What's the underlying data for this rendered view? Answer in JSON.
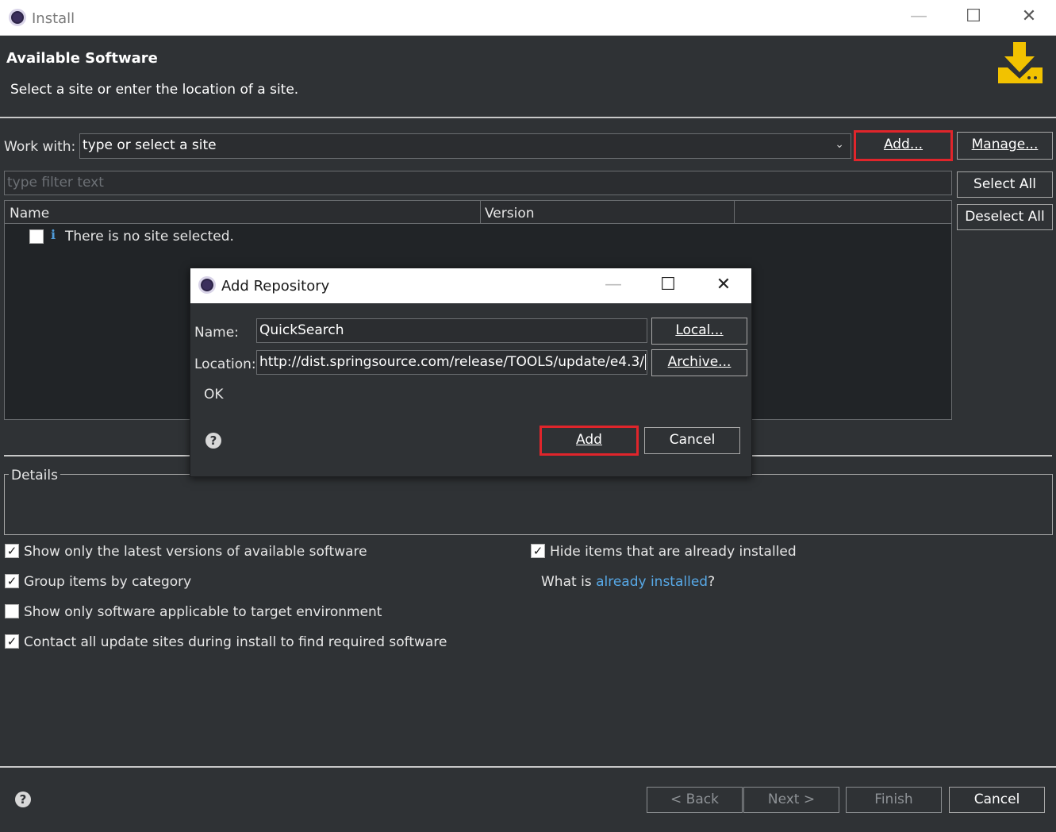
{
  "window": {
    "title": "Install",
    "controls": {
      "minimize": "—",
      "maximize": "☐",
      "close": "✕"
    }
  },
  "header": {
    "title": "Available Software",
    "subtitle": "Select a site or enter the location of a site.",
    "icon": "download-icon",
    "icon_color": "#f2c200"
  },
  "work_with": {
    "label": "Work with:",
    "placeholder": "type or select a site",
    "add_button": "Add...",
    "manage_button": "Manage..."
  },
  "filter": {
    "placeholder": "type filter text"
  },
  "side_buttons": {
    "select_all": "Select All",
    "deselect_all": "Deselect All"
  },
  "table": {
    "columns": [
      "Name",
      "Version",
      ""
    ],
    "rows": [
      {
        "checked": false,
        "icon": "info-icon",
        "text": "There is no site selected."
      }
    ]
  },
  "details": {
    "label": "Details"
  },
  "options": {
    "left": [
      {
        "label": "Show only the latest versions of available software",
        "checked": true
      },
      {
        "label": "Group items by category",
        "checked": true
      },
      {
        "label": "Show only software applicable to target environment",
        "checked": false
      },
      {
        "label": "Contact all update sites during install to find required software",
        "checked": true
      }
    ],
    "right": [
      {
        "label": "Hide items that are already installed",
        "checked": true
      }
    ],
    "already_installed": {
      "prefix": "What is ",
      "link": "already installed",
      "suffix": "?"
    }
  },
  "footer": {
    "back": "< Back",
    "next": "Next >",
    "finish": "Finish",
    "cancel": "Cancel"
  },
  "dialog": {
    "title": "Add Repository",
    "name_label": "Name:",
    "name_value": "QuickSearch",
    "location_label": "Location:",
    "location_value": "http://dist.springsource.com/release/TOOLS/update/e4.3/",
    "local_button": "Local...",
    "archive_button": "Archive...",
    "status": "OK",
    "add_button": "Add",
    "cancel_button": "Cancel",
    "controls": {
      "minimize": "—",
      "maximize": "☐",
      "close": "✕"
    }
  },
  "colors": {
    "background": "#2f3235",
    "highlight": "#e0252b",
    "link": "#57a8e6"
  }
}
